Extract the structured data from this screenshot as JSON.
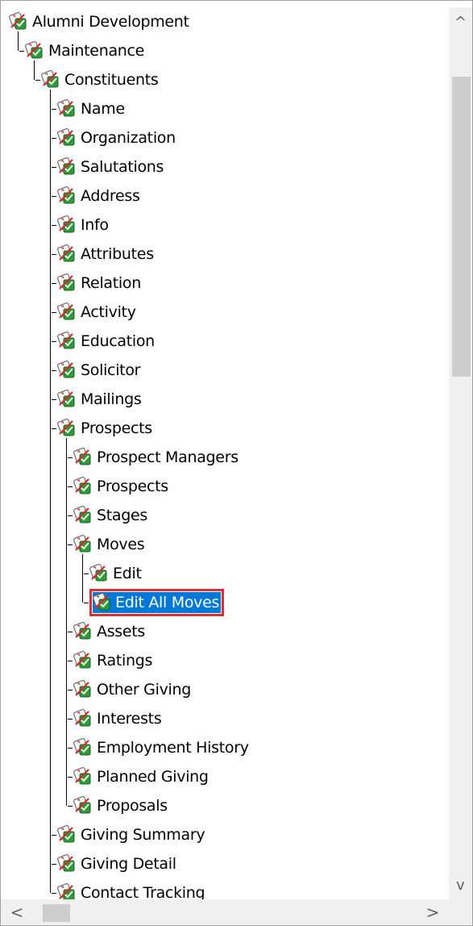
{
  "tree": {
    "nodes": [
      {
        "label": "Alumni Development",
        "depth": 0,
        "icon": "module-check-icon"
      },
      {
        "label": "Maintenance",
        "depth": 1,
        "icon": "module-check-icon"
      },
      {
        "label": "Constituents",
        "depth": 2,
        "icon": "module-check-icon"
      },
      {
        "label": "Name",
        "depth": 3,
        "icon": "module-check-icon"
      },
      {
        "label": "Organization",
        "depth": 3,
        "icon": "module-check-icon"
      },
      {
        "label": "Salutations",
        "depth": 3,
        "icon": "module-check-icon"
      },
      {
        "label": "Address",
        "depth": 3,
        "icon": "module-check-icon"
      },
      {
        "label": "Info",
        "depth": 3,
        "icon": "module-check-icon"
      },
      {
        "label": "Attributes",
        "depth": 3,
        "icon": "module-check-icon"
      },
      {
        "label": "Relation",
        "depth": 3,
        "icon": "module-check-icon"
      },
      {
        "label": "Activity",
        "depth": 3,
        "icon": "module-check-icon"
      },
      {
        "label": "Education",
        "depth": 3,
        "icon": "module-check-icon"
      },
      {
        "label": "Solicitor",
        "depth": 3,
        "icon": "module-check-icon"
      },
      {
        "label": "Mailings",
        "depth": 3,
        "icon": "module-check-icon"
      },
      {
        "label": "Prospects",
        "depth": 3,
        "icon": "module-check-icon"
      },
      {
        "label": "Prospect Managers",
        "depth": 4,
        "icon": "module-check-icon"
      },
      {
        "label": "Prospects",
        "depth": 4,
        "icon": "module-check-icon"
      },
      {
        "label": "Stages",
        "depth": 4,
        "icon": "module-check-icon"
      },
      {
        "label": "Moves",
        "depth": 4,
        "icon": "module-check-icon"
      },
      {
        "label": "Edit",
        "depth": 5,
        "icon": "module-check-icon"
      },
      {
        "label": "Edit All Moves",
        "depth": 5,
        "icon": "module-check-icon",
        "selected": true
      },
      {
        "label": "Assets",
        "depth": 4,
        "icon": "module-check-icon"
      },
      {
        "label": "Ratings",
        "depth": 4,
        "icon": "module-check-icon"
      },
      {
        "label": "Other Giving",
        "depth": 4,
        "icon": "module-check-icon"
      },
      {
        "label": "Interests",
        "depth": 4,
        "icon": "module-check-icon"
      },
      {
        "label": "Employment History",
        "depth": 4,
        "icon": "module-check-icon"
      },
      {
        "label": "Planned Giving",
        "depth": 4,
        "icon": "module-check-icon"
      },
      {
        "label": "Proposals",
        "depth": 4,
        "icon": "module-check-icon"
      },
      {
        "label": "Giving Summary",
        "depth": 3,
        "icon": "module-check-icon"
      },
      {
        "label": "Giving Detail",
        "depth": 3,
        "icon": "module-check-icon"
      },
      {
        "label": "Contact Tracking",
        "depth": 3,
        "icon": "module-check-icon"
      }
    ]
  },
  "scrollbars": {
    "vertical": {
      "up_icon": "chevron-up-icon",
      "down_icon": "chevron-down-icon",
      "up_glyph": "^",
      "down_glyph": "v"
    },
    "horizontal": {
      "left_icon": "chevron-left-icon",
      "right_icon": "chevron-right-icon",
      "left_glyph": "<",
      "right_glyph": ">"
    }
  },
  "colors": {
    "selection_bg": "#0078d7",
    "selection_highlight_border": "#d3303a"
  }
}
